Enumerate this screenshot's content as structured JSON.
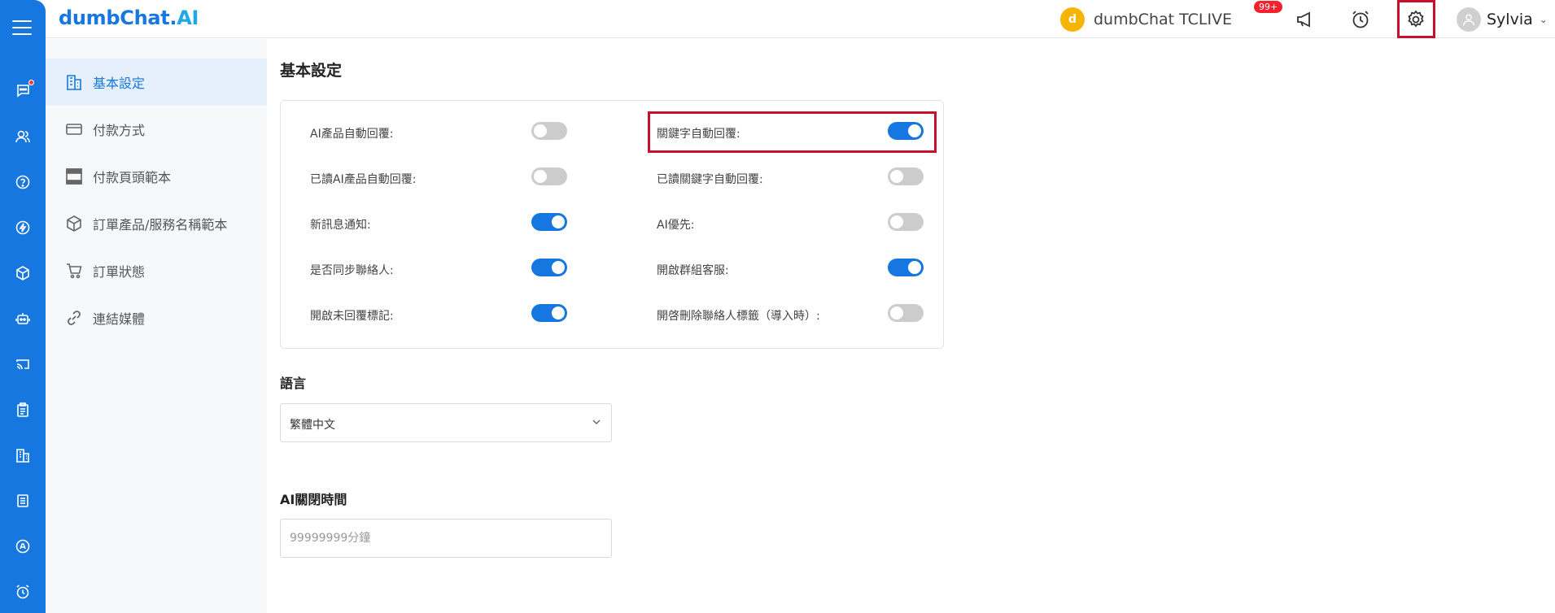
{
  "app": {
    "logo_main": "dumbChat.",
    "logo_ai": "AI"
  },
  "header": {
    "brand_initial": "d",
    "brand_name": "dumbChat TCLIVE",
    "notification_badge": "99+",
    "user_name": "Sylvia"
  },
  "rail": {
    "icons": [
      "menu-icon",
      "chat-icon",
      "contacts-icon",
      "help-icon",
      "flash-icon",
      "package-icon",
      "robot-icon",
      "cast-icon",
      "clipboard-icon",
      "building-icon",
      "document-icon",
      "ai-icon",
      "alarm-icon"
    ],
    "chat_has_alert": true
  },
  "sidebar": {
    "items": [
      {
        "label": "基本設定",
        "icon": "building-icon",
        "active": true
      },
      {
        "label": "付款方式",
        "icon": "credit-card-icon",
        "active": false
      },
      {
        "label": "付款頁頭範本",
        "icon": "page-header-icon",
        "active": false
      },
      {
        "label": "訂單產品/服務名稱範本",
        "icon": "box-icon",
        "active": false
      },
      {
        "label": "訂單狀態",
        "icon": "cart-icon",
        "active": false
      },
      {
        "label": "連結媒體",
        "icon": "link-icon",
        "active": false
      }
    ]
  },
  "main": {
    "title": "基本設定",
    "settings_left": [
      {
        "label": "AI產品自動回覆:",
        "on": false
      },
      {
        "label": "已讀AI產品自動回覆:",
        "on": false
      },
      {
        "label": "新訊息通知:",
        "on": true
      },
      {
        "label": "是否同步聯絡人:",
        "on": true
      },
      {
        "label": "開啟未回覆標記:",
        "on": true
      }
    ],
    "settings_right": [
      {
        "label": "關鍵字自動回覆:",
        "on": true
      },
      {
        "label": "已讀關鍵字自動回覆:",
        "on": false
      },
      {
        "label": "AI優先:",
        "on": false
      },
      {
        "label": "開啟群組客服:",
        "on": true
      },
      {
        "label": "開啓刪除聯絡人標籤（導入時）:",
        "on": false
      }
    ],
    "language_label": "語言",
    "language_value": "繁體中文",
    "ai_off_label": "AI關閉時間",
    "ai_off_placeholder": "99999999分鐘"
  },
  "colors": {
    "accent": "#1677e0",
    "highlight": "#c8102e",
    "toggle_off": "#cccccc"
  }
}
